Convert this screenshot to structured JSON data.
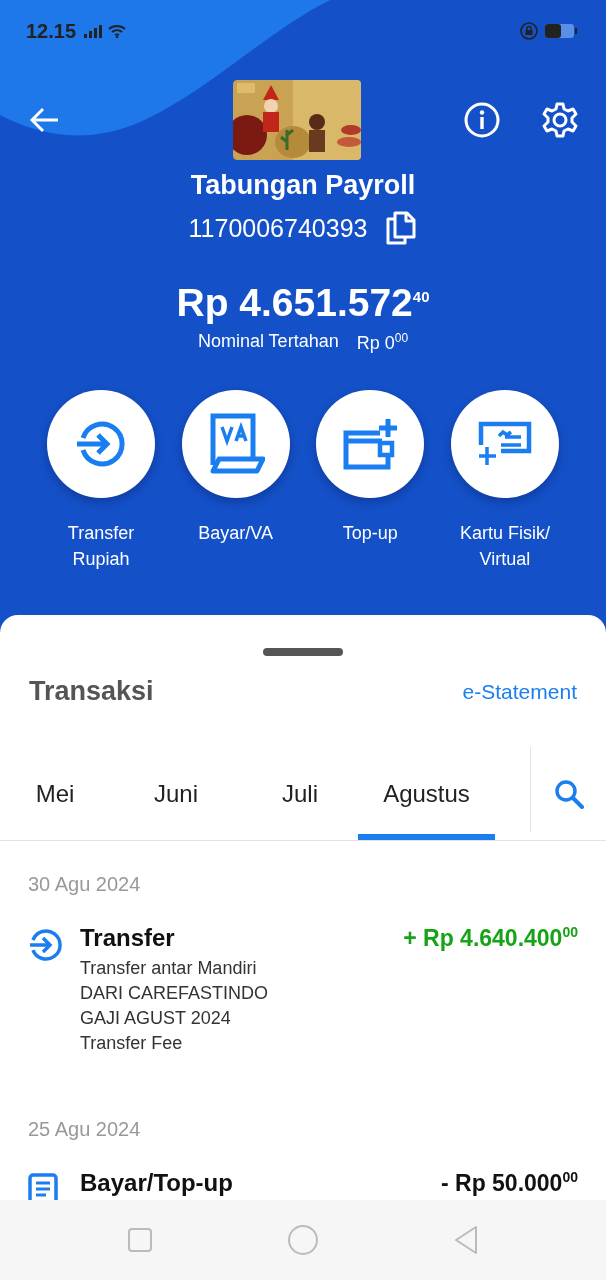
{
  "status_bar": {
    "time": "12.15"
  },
  "account": {
    "name": "Tabungan Payroll",
    "number": "1170006740393",
    "balance": "Rp 4.651.572$^{40}$",
    "held_label": "Nominal Tertahan",
    "held_amount": "Rp 0$^{00}$"
  },
  "actions": [
    {
      "kind": "transfer",
      "label": "Transfer Rupiah"
    },
    {
      "kind": "va",
      "label": "Bayar/VA"
    },
    {
      "kind": "topup",
      "label": "Top-up"
    },
    {
      "kind": "card",
      "label": "Kartu Fisik/ Virtual"
    }
  ],
  "transactions_panel": {
    "title": "Transaksi",
    "link": "e-Statement"
  },
  "tabs": [
    {
      "label": "Mei",
      "selected": false
    },
    {
      "label": "Juni",
      "selected": false
    },
    {
      "label": "Juli",
      "selected": false
    },
    {
      "label": "Agustus",
      "selected": true
    }
  ],
  "groups": [
    {
      "date": "30 Agu 2024",
      "items": [
        {
          "kind": "transfer",
          "incoming": true,
          "title": "Transfer",
          "amount": "+ Rp 4.640.400$^{00}$",
          "details": [
            "Transfer antar Mandiri",
            "DARI CAREFASTINDO",
            "GAJI AGUST 2024",
            "Transfer Fee"
          ]
        }
      ]
    },
    {
      "date": "25 Agu 2024",
      "items": [
        {
          "kind": "bill",
          "incoming": false,
          "title": "Bayar/Top-up",
          "amount": "- Rp 50.000$^{00}$"
        }
      ]
    }
  ]
}
